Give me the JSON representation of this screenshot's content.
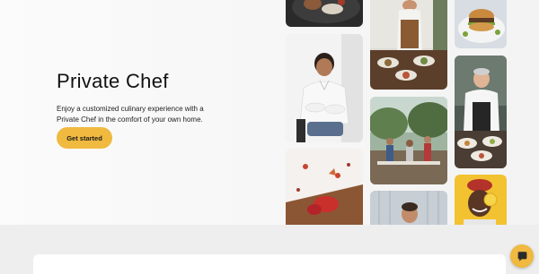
{
  "hero": {
    "title": "Private Chef",
    "description": "Enjoy a customized culinary experience with a Private Chef in the comfort of your own home.",
    "cta_label": "Get started"
  },
  "chat": {
    "icon": "chat-bubble-icon"
  },
  "colors": {
    "accent": "#f0b93f",
    "hero_background": "#f7f7f7",
    "footer_background": "#eeeeee"
  }
}
